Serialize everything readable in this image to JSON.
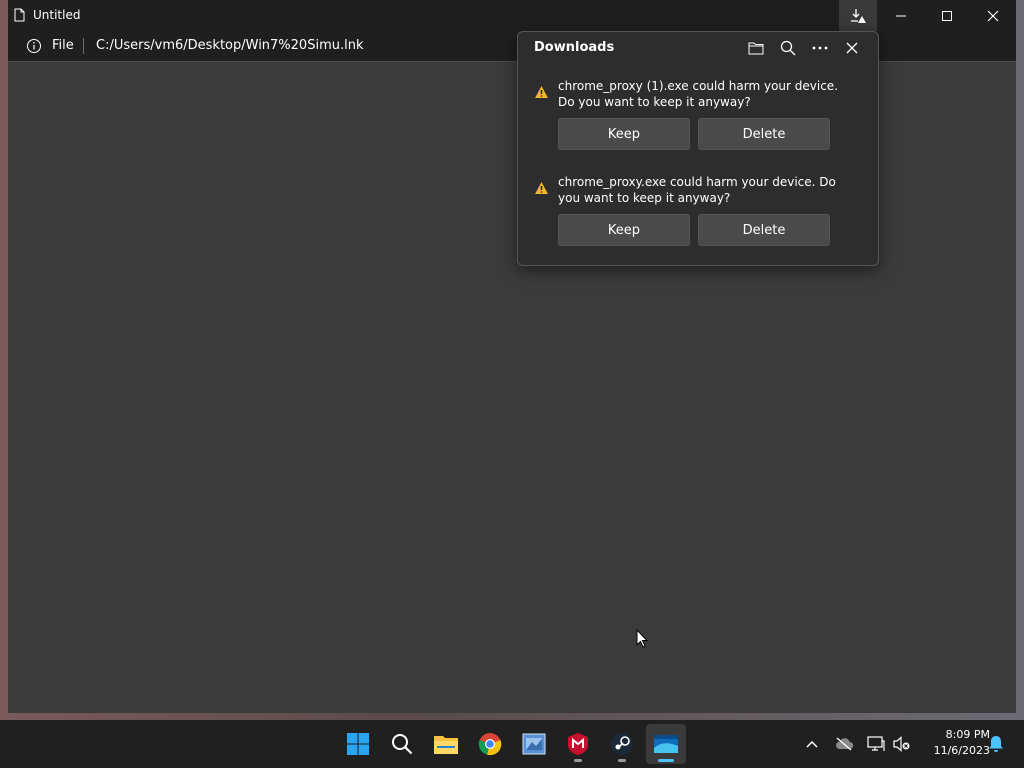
{
  "window": {
    "title": "Untitled",
    "address": {
      "file_label": "File",
      "url": "C:/Users/vm6/Desktop/Win7%20Simu.lnk"
    }
  },
  "downloads": {
    "title": "Downloads",
    "items": [
      {
        "message": "chrome_proxy (1).exe could harm your device. Do you want to keep it anyway?",
        "keep_label": "Keep",
        "delete_label": "Delete"
      },
      {
        "message": "chrome_proxy.exe could harm your device. Do you want to keep it anyway?",
        "keep_label": "Keep",
        "delete_label": "Delete"
      }
    ]
  },
  "taskbar": {
    "apps": [
      "windows-start",
      "search",
      "file-explorer",
      "chrome",
      "app-window",
      "mcafee",
      "steam",
      "edge-window"
    ],
    "clock": {
      "time": "8:09 PM",
      "date": "11/6/2023"
    }
  },
  "colors": {
    "warning": "#f2b233",
    "accent": "#4cc2ff",
    "window_bg": "#3b3b3b",
    "titlebar_bg": "#1f1f1f"
  }
}
